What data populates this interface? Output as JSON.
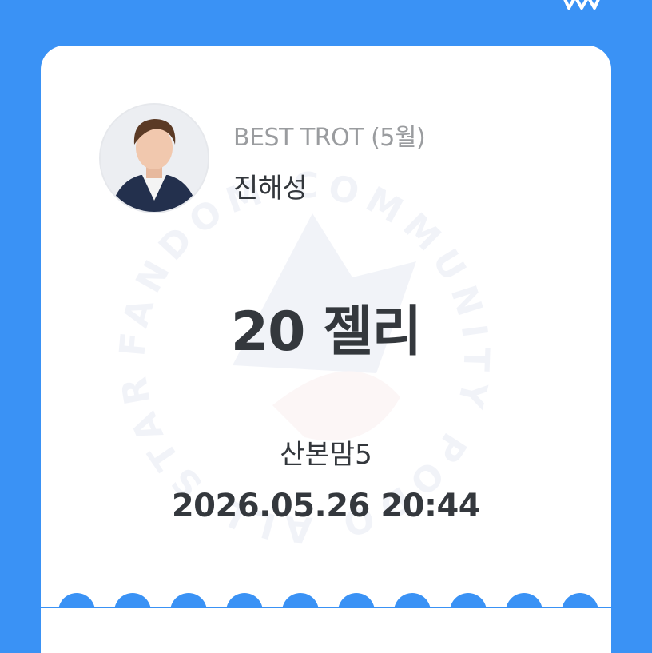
{
  "ticket": {
    "category": "BEST TROT (5월)",
    "artist_name": "진해성",
    "amount": "20 젤리",
    "sender": "산본맘5",
    "datetime": "2026.05.26 20:44"
  },
  "watermark": {
    "text": "FANDOM COMMUNITY PODO ALL STARS MEETING",
    "colors": [
      "#6d7fb8",
      "#e1a0a6"
    ]
  },
  "colors": {
    "background": "#3a92f5",
    "card": "#ffffff"
  },
  "icons": [
    "avatar",
    "crown-icon"
  ]
}
